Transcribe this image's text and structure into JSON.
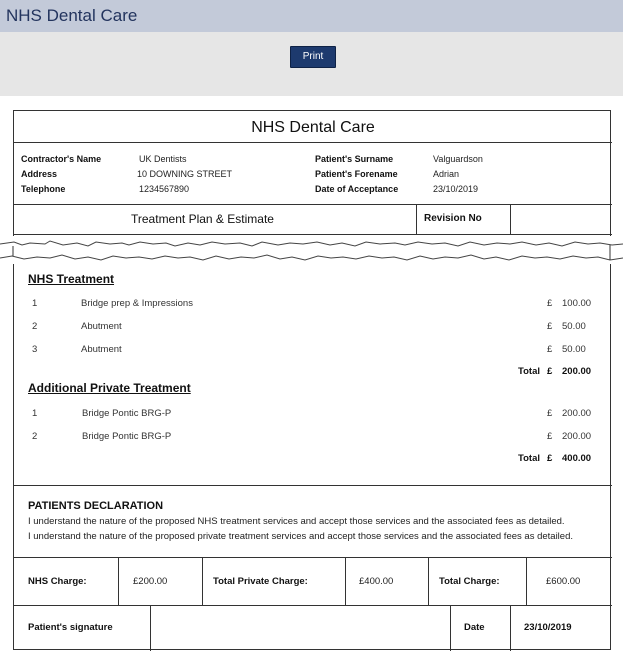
{
  "app": {
    "title": "NHS Dental Care"
  },
  "toolbar": {
    "print_label": "Print"
  },
  "document": {
    "title": "NHS Dental Care",
    "contractor": {
      "name_label": "Contractor's Name",
      "name": "UK Dentists",
      "address_label": "Address",
      "address": "10 DOWNING STREET",
      "telephone_label": "Telephone",
      "telephone": "1234567890"
    },
    "patient": {
      "surname_label": "Patient's Surname",
      "surname": "Valguardson",
      "forename_label": "Patient's Forename",
      "forename": "Adrian",
      "acceptance_label": "Date of Acceptance",
      "acceptance": "23/10/2019"
    },
    "plan_header": {
      "title": "Treatment Plan & Estimate",
      "revision_label": "Revision No",
      "revision_value": ""
    },
    "nhs_treatment": {
      "heading": "NHS Treatment",
      "items": [
        {
          "num": "1",
          "name": "Bridge prep & Impressions",
          "currency": "£",
          "amount": "100.00"
        },
        {
          "num": "2",
          "name": "Abutment",
          "currency": "£",
          "amount": "50.00"
        },
        {
          "num": "3",
          "name": "Abutment",
          "currency": "£",
          "amount": "50.00"
        }
      ],
      "total_label": "Total",
      "total_currency": "£",
      "total": "200.00"
    },
    "private_treatment": {
      "heading": "Additional Private Treatment",
      "items": [
        {
          "num": "1",
          "name": "Bridge Pontic BRG-P",
          "currency": "£",
          "amount": "200.00"
        },
        {
          "num": "2",
          "name": "Bridge Pontic BRG-P",
          "currency": "£",
          "amount": "200.00"
        }
      ],
      "total_label": "Total",
      "total_currency": "£",
      "total": "400.00"
    },
    "declaration": {
      "heading": "PATIENTS DECLARATION",
      "line1": "I understand the nature of the proposed NHS treatment services and accept those services and the associated fees as detailed.",
      "line2": "I understand the nature of the proposed private treatment services and accept those services and the associated fees as detailed."
    },
    "charges": {
      "nhs_label": "NHS Charge:",
      "nhs": "£200.00",
      "private_label": "Total Private Charge:",
      "private": "£400.00",
      "total_label": "Total Charge:",
      "total": "£600.00"
    },
    "signature": {
      "label": "Patient's signature",
      "date_label": "Date",
      "date": "23/10/2019"
    }
  },
  "colors": {
    "header_bg": "#c3cad9",
    "title_color": "#23345e",
    "toolbar_bg": "#e6e6e6",
    "button_bg": "#1d3a6e"
  }
}
